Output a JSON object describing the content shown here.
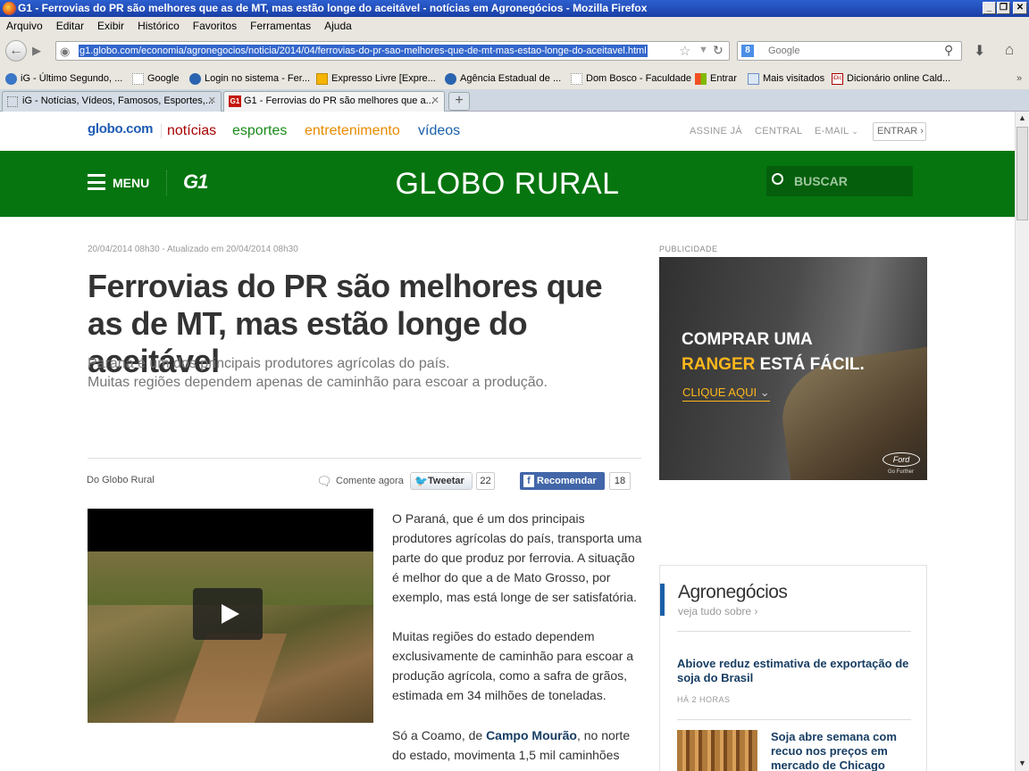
{
  "window": {
    "title": "G1 - Ferrovias do PR são melhores que as de MT, mas estão longe do aceitável - notícias em Agronegócios - Mozilla Firefox"
  },
  "menu": [
    "Arquivo",
    "Editar",
    "Exibir",
    "Histórico",
    "Favoritos",
    "Ferramentas",
    "Ajuda"
  ],
  "nav": {
    "url": "g1.globo.com/economia/agronegocios/noticia/2014/04/ferrovias-do-pr-sao-melhores-que-de-mt-mas-estao-longe-do-aceitavel.html",
    "search_placeholder": "Google"
  },
  "bookmarks": [
    "iG - Último Segundo, ...",
    "Google",
    "Login no sistema - Fer...",
    "Expresso Livre [Expre...",
    "Agência Estadual de ...",
    "Dom Bosco - Faculdade",
    "Entrar",
    "Mais visitados",
    "Dicionário online Cald..."
  ],
  "tabs": [
    {
      "label": "iG - Notícias, Vídeos, Famosos, Esportes,..."
    },
    {
      "label": "G1 - Ferrovias do PR são melhores que a..."
    }
  ],
  "globo_bar": {
    "logo": "globo.com",
    "noticias": "notícias",
    "esportes": "esportes",
    "entretenimento": "entretenimento",
    "videos": "vídeos",
    "assine": "ASSINE JÁ",
    "central": "CENTRAL",
    "email": "E-MAIL",
    "entrar": "ENTRAR"
  },
  "header": {
    "menu": "MENU",
    "g1": "G1",
    "section": "GLOBO RURAL",
    "search": "BUSCAR"
  },
  "article": {
    "date": "20/04/2014 08h30 - Atualizado em 20/04/2014 08h30",
    "headline": "Ferrovias do PR são melhores que as de MT, mas estão longe do aceitável",
    "subtitle_1": "Paraná é um dos principais produtores agrícolas do país.",
    "subtitle_2": "Muitas regiões dependem apenas de caminhão para escoar a produção.",
    "source": "Do Globo Rural",
    "comment": "Comente agora",
    "tweet": "Tweetar",
    "tweet_count": "22",
    "recommend": "Recomendar",
    "recommend_count": "18",
    "p1": "O Paraná, que é um dos principais produtores agrícolas do país, transporta uma parte do que produz por ferrovia. A situação é melhor do que a de Mato Grosso, por exemplo, mas está longe de ser satisfatória.",
    "p2": "Muitas regiões do estado dependem exclusivamente de caminhão para escoar a produção agrícola, como a safra de grãos, estimada em 34 milhões de toneladas.",
    "p3_a": "Só a Coamo, de ",
    "p3_link": "Campo Mourão",
    "p3_b": ", no norte do estado, movimenta 1,5 mil caminhões"
  },
  "ad": {
    "label": "PUBLICIDADE",
    "line1": "COMPRAR UMA",
    "line2a": "RANGER",
    "line2b": " ESTÁ FÁCIL.",
    "cta": "CLIQUE AQUI",
    "brand": "Ford",
    "tag": "Go Further"
  },
  "sidebar": {
    "title": "Agronegócios",
    "see_all": "veja tudo sobre ›",
    "items": [
      {
        "headline": "Abiove reduz estimativa de exportação de soja do Brasil",
        "time": "HÁ 2 HORAS"
      },
      {
        "headline": "Soja abre semana com recuo nos preços em mercado de Chicago"
      }
    ]
  },
  "colors": {
    "globo_green": "#06750f",
    "noticias": "#a80000",
    "esportes": "#1b8a1b",
    "entretenimento": "#e88a00",
    "videos": "#1a60a8",
    "link": "#173e63"
  }
}
